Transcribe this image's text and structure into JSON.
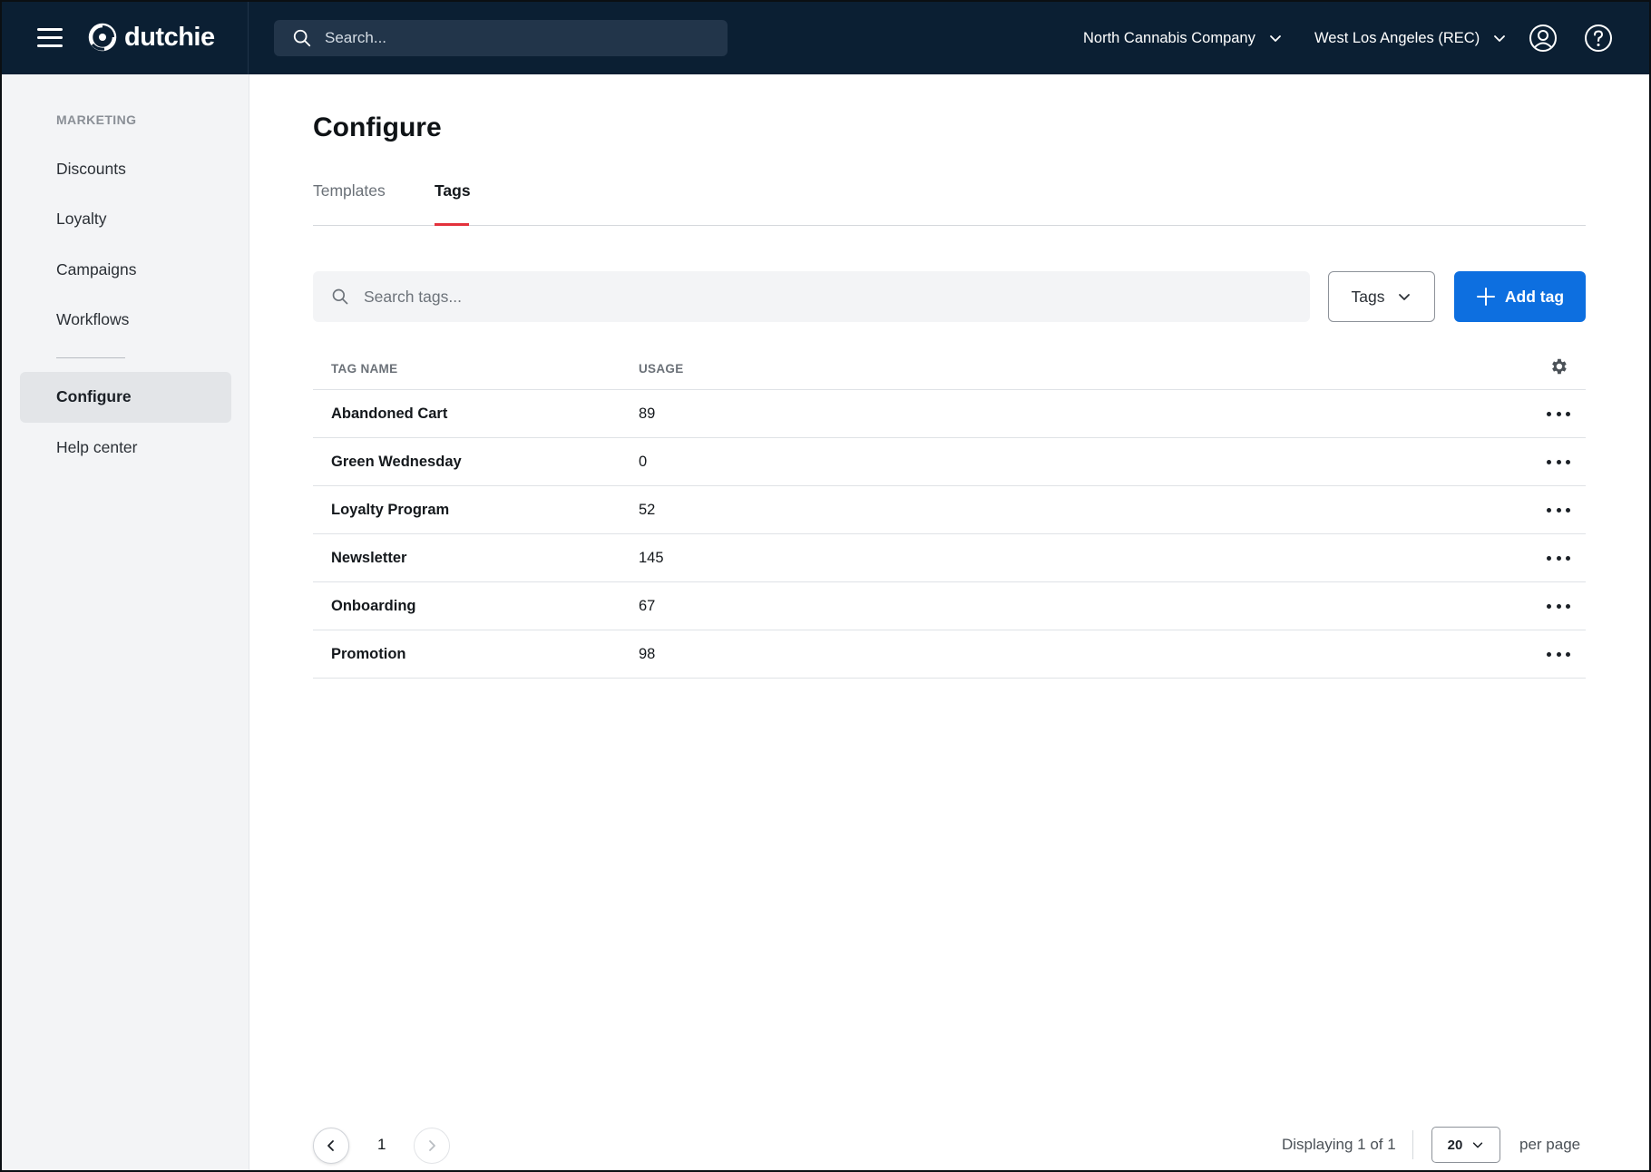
{
  "app": {
    "brand": "dutchie",
    "search_placeholder": "Search...",
    "company": "North Cannabis Company",
    "location": "West Los Angeles (REC)"
  },
  "sidebar": {
    "section_label": "MARKETING",
    "items": [
      {
        "label": "Discounts"
      },
      {
        "label": "Loyalty"
      },
      {
        "label": "Campaigns"
      },
      {
        "label": "Workflows"
      }
    ],
    "active_item": "Configure",
    "help_item": "Help center"
  },
  "main": {
    "title": "Configure",
    "tabs": [
      {
        "label": "Templates",
        "active": false
      },
      {
        "label": "Tags",
        "active": true
      }
    ],
    "tag_search_placeholder": "Search tags...",
    "filter_label": "Tags",
    "add_button_label": "Add tag"
  },
  "table": {
    "columns": [
      "TAG NAME",
      "USAGE"
    ],
    "rows": [
      {
        "name": "Abandoned Cart",
        "usage": "89"
      },
      {
        "name": "Green Wednesday",
        "usage": "0"
      },
      {
        "name": "Loyalty Program",
        "usage": "52"
      },
      {
        "name": "Newsletter",
        "usage": "145"
      },
      {
        "name": "Onboarding",
        "usage": "67"
      },
      {
        "name": "Promotion",
        "usage": "98"
      }
    ]
  },
  "pagination": {
    "current_page": "1",
    "displaying": "Displaying 1 of 1",
    "per_page_value": "20",
    "per_page_label": "per page"
  },
  "colors": {
    "topbar": "#0b1f33",
    "accent_blue": "#0d6fe0",
    "tab_underline": "#e3323c",
    "sidebar_bg": "#f3f4f6"
  },
  "icons": {
    "menu": "hamburger-icon",
    "logo": "dutchie-logo-icon",
    "search": "search-icon",
    "chevron": "chevron-down-icon",
    "user": "user-circle-icon",
    "help": "help-circle-icon",
    "plus": "plus-icon",
    "settings": "gear-icon",
    "more": "more-horizontal-icon",
    "prev": "chevron-left-icon",
    "next": "chevron-right-icon"
  }
}
